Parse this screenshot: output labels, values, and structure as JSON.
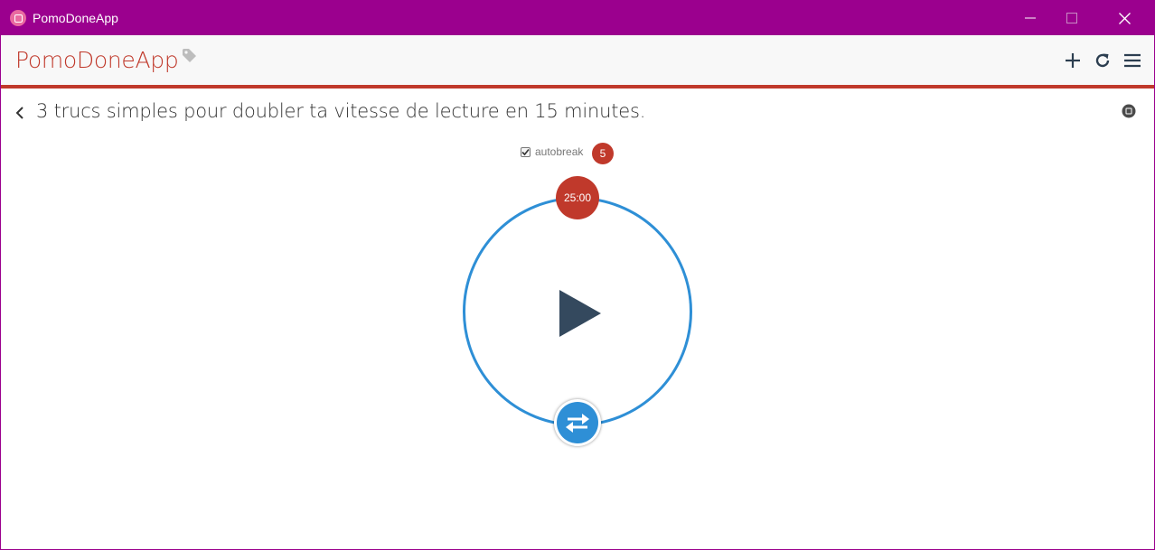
{
  "window": {
    "title": "PomoDoneApp"
  },
  "appbar": {
    "brand": "PomoDoneApp"
  },
  "task": {
    "title": "3 trucs simples pour doubler ta vitesse de lecture en 15 minutes."
  },
  "autobreak": {
    "label": "autobreak",
    "checked": true,
    "count": "5"
  },
  "timer": {
    "time": "25:00"
  },
  "icons": {
    "app": "app-icon",
    "tag": "tag-icon",
    "add": "plus-icon",
    "refresh": "refresh-icon",
    "menu": "hamburger-menu-icon",
    "back": "chevron-left-icon",
    "stop": "stop-icon",
    "play": "play-icon",
    "switch": "swap-arrows-icon"
  },
  "colors": {
    "titlebar": "#9b008e",
    "accent": "#c0392b",
    "ring": "#2e8fd6",
    "play": "#34495e"
  }
}
